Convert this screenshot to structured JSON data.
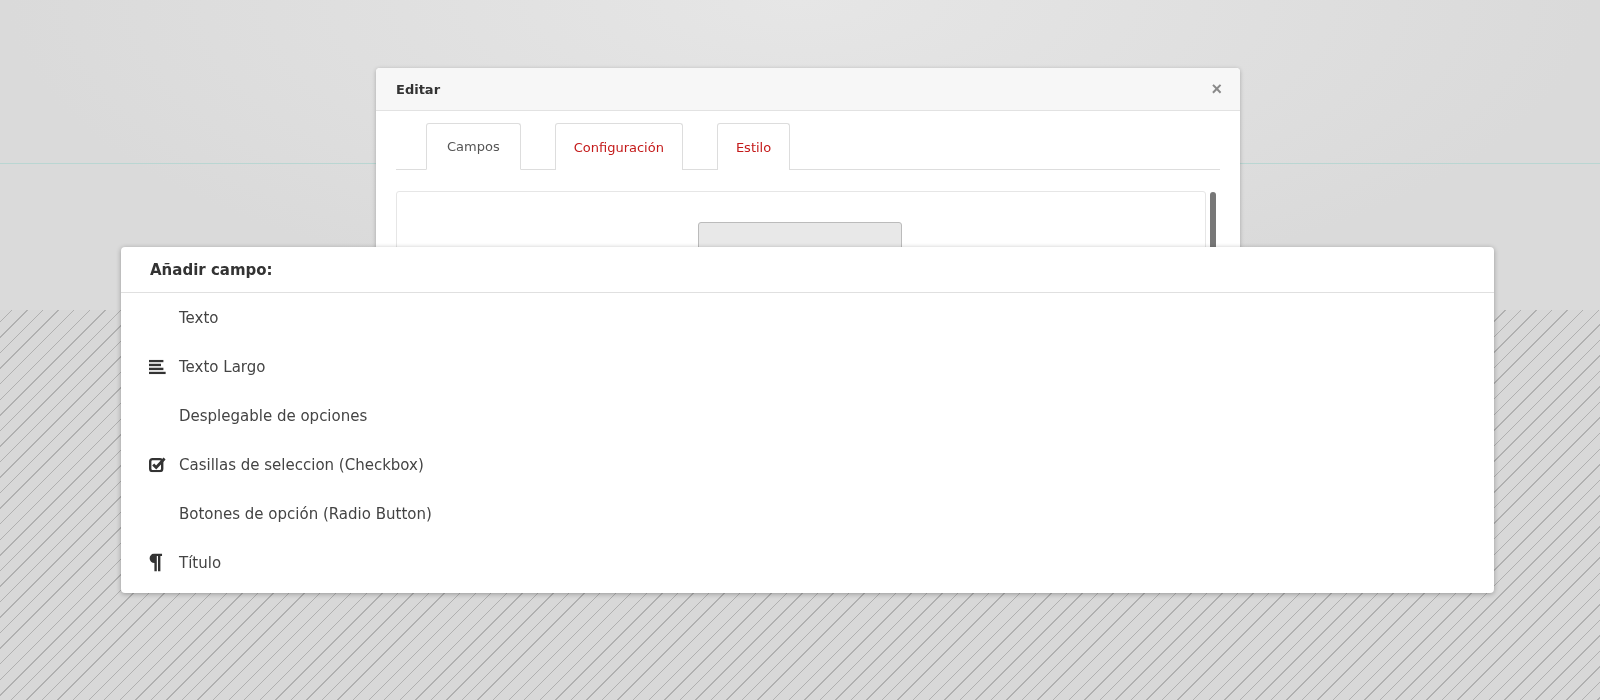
{
  "dialog": {
    "title": "Editar",
    "close": "×",
    "tabs": [
      {
        "label": "Campos",
        "selected": true
      },
      {
        "label": "Configuración",
        "selected": false
      },
      {
        "label": "Estilo",
        "selected": false
      }
    ]
  },
  "menu": {
    "title": "Añadir campo:",
    "items": [
      {
        "label": "Texto",
        "kind": "plain"
      },
      {
        "label": "Texto Largo",
        "kind": "long-text"
      },
      {
        "label": "Desplegable de opciones",
        "kind": "plain"
      },
      {
        "label": "Casillas de seleccion (Checkbox)",
        "kind": "checkbox"
      },
      {
        "label": "Botones de opción (Radio Button)",
        "kind": "plain"
      },
      {
        "label": "Título",
        "kind": "heading"
      }
    ]
  }
}
